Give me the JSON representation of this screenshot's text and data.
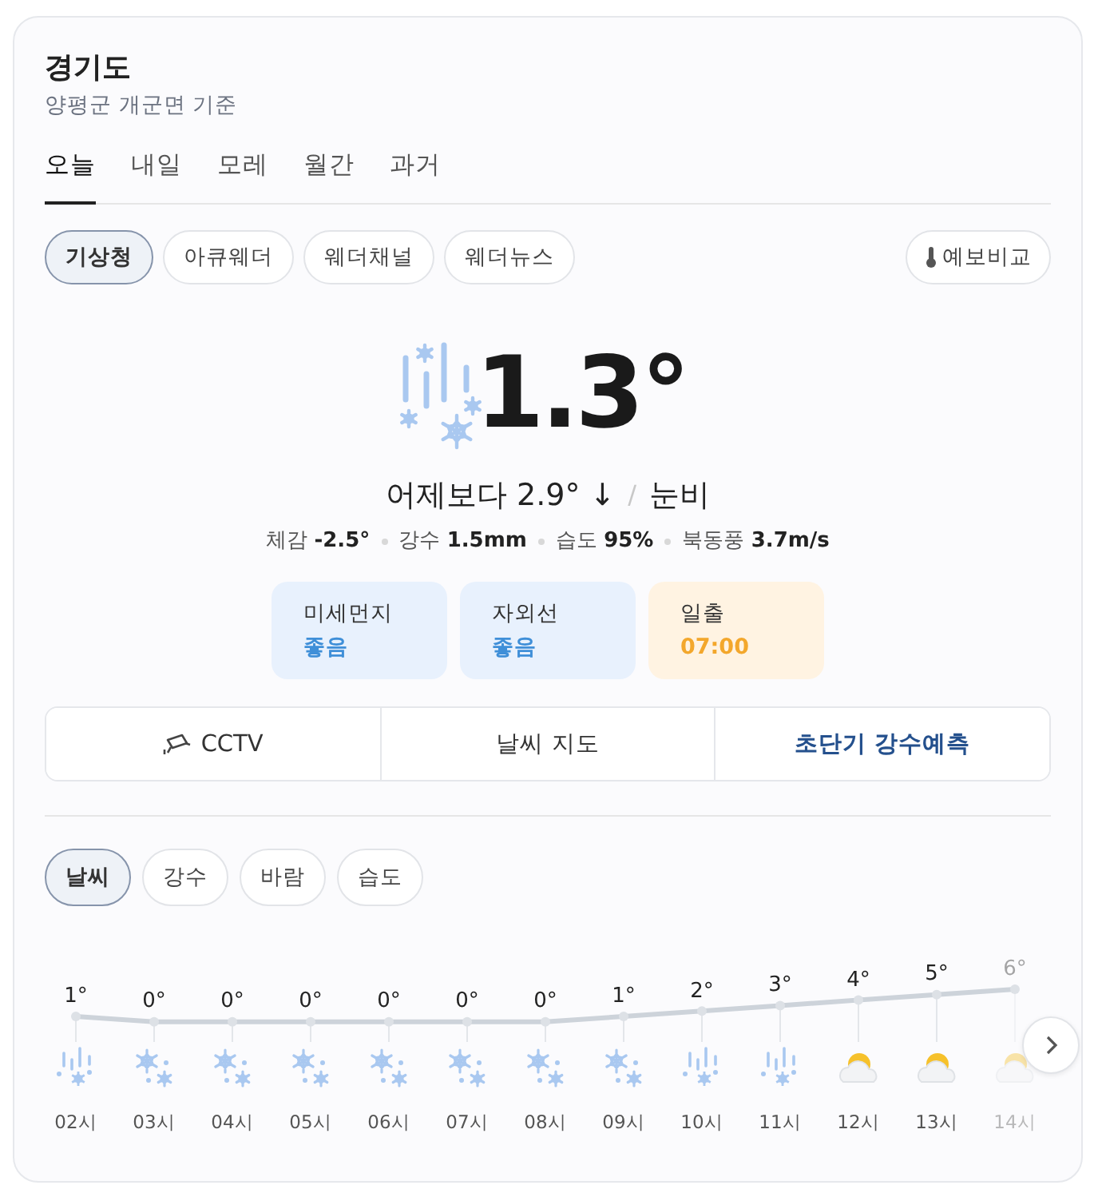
{
  "location": {
    "title": "경기도",
    "subtitle": "양평군 개군면 기준"
  },
  "day_tabs": [
    {
      "label": "오늘",
      "selected": true
    },
    {
      "label": "내일",
      "selected": false
    },
    {
      "label": "모레",
      "selected": false
    },
    {
      "label": "월간",
      "selected": false
    },
    {
      "label": "과거",
      "selected": false
    }
  ],
  "sources": [
    {
      "label": "기상청",
      "selected": true
    },
    {
      "label": "아큐웨더",
      "selected": false
    },
    {
      "label": "웨더채널",
      "selected": false
    },
    {
      "label": "웨더뉴스",
      "selected": false
    }
  ],
  "compare_button": "예보비교",
  "current": {
    "temperature": "1.3°",
    "comparison": "어제보다 2.9° ↓",
    "separator": "/",
    "condition": "눈비",
    "details": [
      "체감 **-2.5°**",
      "강수 **1.5mm**",
      "습도 **95%**",
      "북동풍 **3.7m/s**"
    ]
  },
  "indicators": [
    {
      "label": "미세먼지",
      "value": "좋음",
      "kind": "air"
    },
    {
      "label": "자외선",
      "value": "좋음",
      "kind": "air"
    },
    {
      "label": "일출",
      "value": "07:00",
      "kind": "sun"
    }
  ],
  "links": [
    {
      "label": "CCTV",
      "kind": "cctv",
      "highlighted": false
    },
    {
      "label": "날씨 지도",
      "kind": "plain",
      "highlighted": false
    },
    {
      "label": "초단기 강수예측",
      "kind": "plain",
      "highlighted": true
    }
  ],
  "chart_tabs": [
    {
      "label": "날씨",
      "selected": true
    },
    {
      "label": "강수",
      "selected": false
    },
    {
      "label": "바람",
      "selected": false
    },
    {
      "label": "습도",
      "selected": false
    }
  ],
  "hourly": [
    {
      "time": "02시",
      "temp": "1°",
      "kind": "sleet",
      "faded": false
    },
    {
      "time": "03시",
      "temp": "0°",
      "kind": "snow",
      "faded": false
    },
    {
      "time": "04시",
      "temp": "0°",
      "kind": "snow",
      "faded": false
    },
    {
      "time": "05시",
      "temp": "0°",
      "kind": "snow",
      "faded": false
    },
    {
      "time": "06시",
      "temp": "0°",
      "kind": "snow",
      "faded": false
    },
    {
      "time": "07시",
      "temp": "0°",
      "kind": "snow",
      "faded": false
    },
    {
      "time": "08시",
      "temp": "0°",
      "kind": "snow",
      "faded": false
    },
    {
      "time": "09시",
      "temp": "1°",
      "kind": "snow",
      "faded": false
    },
    {
      "time": "10시",
      "temp": "2°",
      "kind": "sleet",
      "faded": false
    },
    {
      "time": "11시",
      "temp": "3°",
      "kind": "sleet",
      "faded": false
    },
    {
      "time": "12시",
      "temp": "4°",
      "kind": "partly_cloudy",
      "faded": false
    },
    {
      "time": "13시",
      "temp": "5°",
      "kind": "partly_cloudy",
      "faded": false
    },
    {
      "time": "14시",
      "temp": "6°",
      "kind": "partly_cloudy",
      "faded": true
    }
  ]
}
